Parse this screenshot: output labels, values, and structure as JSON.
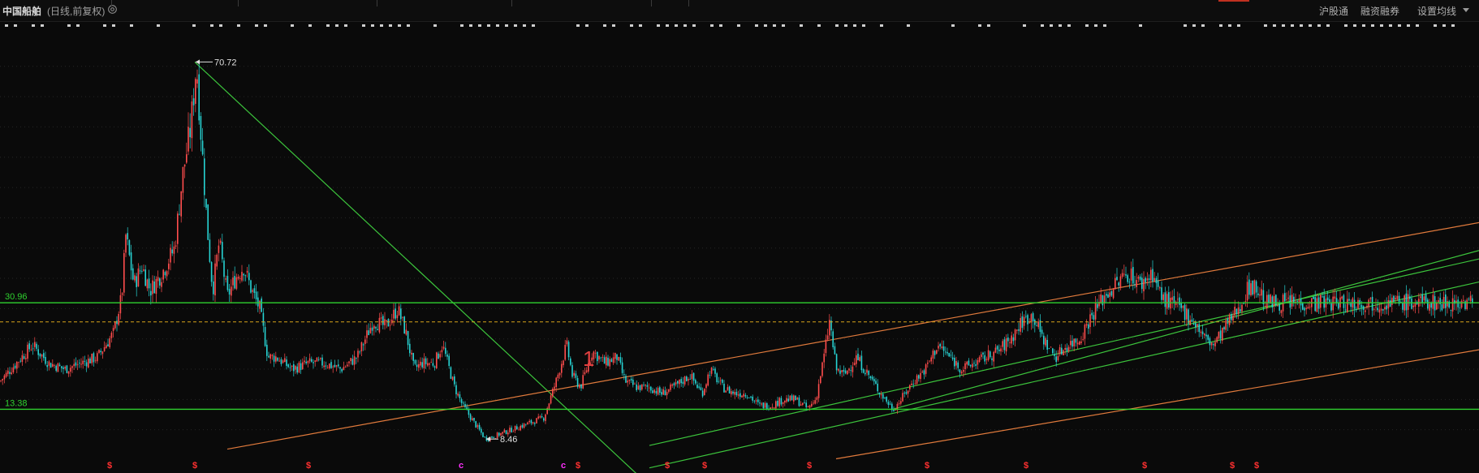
{
  "header": {
    "stock_name": "中国船舶",
    "mode": "(日线,前复权)",
    "settings_icon": "gear-icon",
    "right_links": [
      "沪股通",
      "融资融券",
      "设置均线"
    ],
    "dropdown_icon": "caret-down-icon"
  },
  "colors": {
    "background": "#0a0a0a",
    "candle_up": "#ff4d4d",
    "candle_down": "#27d3d3",
    "support_line": "#2fd12f",
    "trend_green": "#3cc43c",
    "trend_orange": "#e07a3c",
    "dashed_price": "#d8a31a",
    "marker_red": "#ff3030",
    "marker_magenta": "#ff30ff"
  },
  "chart_data": {
    "type": "candlestick",
    "period": "日线",
    "adjustment": "前复权",
    "ylim": [
      5,
      76
    ],
    "high_label": "70.72",
    "low_label": "8.46",
    "horizontal_levels": [
      {
        "label": "30.96",
        "value": 30.96
      },
      {
        "label": "13.38",
        "value": 13.38
      }
    ],
    "current_price_line": 27.8,
    "annotation": "1",
    "price_path": [
      [
        0,
        18
      ],
      [
        20,
        21
      ],
      [
        40,
        24
      ],
      [
        60,
        21
      ],
      [
        80,
        20
      ],
      [
        100,
        21
      ],
      [
        120,
        22
      ],
      [
        140,
        26
      ],
      [
        150,
        32
      ],
      [
        155,
        42
      ],
      [
        165,
        34
      ],
      [
        175,
        37
      ],
      [
        185,
        33
      ],
      [
        200,
        36
      ],
      [
        215,
        40
      ],
      [
        225,
        52
      ],
      [
        235,
        60
      ],
      [
        242,
        70.72
      ],
      [
        248,
        58
      ],
      [
        255,
        44
      ],
      [
        262,
        33
      ],
      [
        270,
        41
      ],
      [
        280,
        32
      ],
      [
        290,
        35
      ],
      [
        300,
        37
      ],
      [
        310,
        33
      ],
      [
        320,
        30
      ],
      [
        330,
        22
      ],
      [
        340,
        22
      ],
      [
        360,
        20
      ],
      [
        380,
        21
      ],
      [
        400,
        21
      ],
      [
        420,
        20
      ],
      [
        440,
        22
      ],
      [
        450,
        25
      ],
      [
        460,
        28
      ],
      [
        475,
        27
      ],
      [
        490,
        30
      ],
      [
        500,
        26
      ],
      [
        510,
        20
      ],
      [
        520,
        21
      ],
      [
        535,
        21
      ],
      [
        545,
        24
      ],
      [
        560,
        17
      ],
      [
        570,
        14
      ],
      [
        580,
        12
      ],
      [
        590,
        10
      ],
      [
        598,
        8.46
      ],
      [
        610,
        9
      ],
      [
        630,
        10
      ],
      [
        650,
        11
      ],
      [
        670,
        12
      ],
      [
        685,
        18
      ],
      [
        698,
        24
      ],
      [
        705,
        19
      ],
      [
        715,
        17
      ],
      [
        730,
        23
      ],
      [
        745,
        21
      ],
      [
        760,
        22
      ],
      [
        770,
        18
      ],
      [
        785,
        17
      ],
      [
        800,
        17
      ],
      [
        815,
        16
      ],
      [
        830,
        17
      ],
      [
        850,
        19
      ],
      [
        865,
        16
      ],
      [
        875,
        20
      ],
      [
        890,
        17
      ],
      [
        905,
        16
      ],
      [
        920,
        16
      ],
      [
        935,
        14
      ],
      [
        950,
        14
      ],
      [
        965,
        15
      ],
      [
        980,
        15
      ],
      [
        995,
        13.5
      ],
      [
        1005,
        15
      ],
      [
        1015,
        22
      ],
      [
        1022,
        28
      ],
      [
        1030,
        20
      ],
      [
        1040,
        19
      ],
      [
        1055,
        22
      ],
      [
        1070,
        19
      ],
      [
        1085,
        16
      ],
      [
        1100,
        13.4
      ],
      [
        1110,
        15
      ],
      [
        1125,
        18
      ],
      [
        1140,
        20
      ],
      [
        1155,
        24
      ],
      [
        1170,
        22
      ],
      [
        1185,
        20
      ],
      [
        1200,
        21
      ],
      [
        1215,
        22
      ],
      [
        1230,
        23
      ],
      [
        1245,
        25
      ],
      [
        1260,
        28
      ],
      [
        1272,
        29
      ],
      [
        1285,
        25
      ],
      [
        1300,
        22
      ],
      [
        1315,
        24
      ],
      [
        1330,
        25
      ],
      [
        1345,
        29
      ],
      [
        1360,
        32
      ],
      [
        1375,
        34
      ],
      [
        1390,
        36
      ],
      [
        1405,
        34
      ],
      [
        1420,
        36
      ],
      [
        1430,
        32
      ],
      [
        1440,
        31
      ],
      [
        1455,
        30
      ],
      [
        1470,
        28
      ],
      [
        1485,
        25
      ],
      [
        1495,
        24
      ],
      [
        1510,
        27
      ],
      [
        1525,
        30
      ],
      [
        1540,
        34
      ],
      [
        1550,
        33
      ],
      [
        1560,
        31
      ]
    ],
    "markers": [
      {
        "x": 135,
        "symbol": "$",
        "color": "red"
      },
      {
        "x": 240,
        "symbol": "$",
        "color": "red"
      },
      {
        "x": 380,
        "symbol": "$",
        "color": "red"
      },
      {
        "x": 568,
        "symbol": "c",
        "color": "magenta"
      },
      {
        "x": 694,
        "symbol": "c",
        "color": "magenta"
      },
      {
        "x": 712,
        "symbol": "$",
        "color": "red"
      },
      {
        "x": 822,
        "symbol": "$",
        "color": "red"
      },
      {
        "x": 868,
        "symbol": "$",
        "color": "red"
      },
      {
        "x": 997,
        "symbol": "$",
        "color": "red"
      },
      {
        "x": 1142,
        "symbol": "$",
        "color": "red"
      },
      {
        "x": 1264,
        "symbol": "$",
        "color": "red"
      },
      {
        "x": 1410,
        "symbol": "$",
        "color": "red"
      },
      {
        "x": 1518,
        "symbol": "$",
        "color": "red"
      },
      {
        "x": 1548,
        "symbol": "$",
        "color": "red"
      }
    ]
  }
}
